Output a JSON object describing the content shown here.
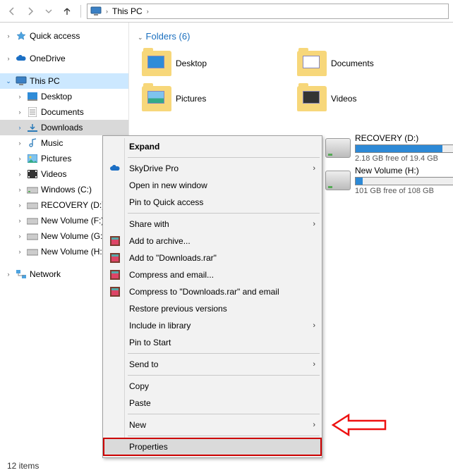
{
  "breadcrumb": {
    "root": "This PC",
    "sep": "›"
  },
  "tree": {
    "quick": "Quick access",
    "onedrive": "OneDrive",
    "thispc": "This PC",
    "desktop": "Desktop",
    "documents": "Documents",
    "downloads": "Downloads",
    "music": "Music",
    "pictures": "Pictures",
    "videos": "Videos",
    "winc": "Windows (C:)",
    "recd": "RECOVERY (D:)",
    "newf": "New Volume (F:)",
    "newg": "New Volume (G:)",
    "newh": "New Volume (H:)",
    "network": "Network"
  },
  "content": {
    "folders_heading": "Folders (6)",
    "f_desktop": "Desktop",
    "f_documents": "Documents",
    "f_pictures": "Pictures",
    "f_videos": "Videos"
  },
  "drives": {
    "rec_name": "RECOVERY (D:)",
    "rec_free": "2.18 GB free of 19.4 GB",
    "newh_name": "New Volume (H:)",
    "newh_free": "101 GB free of 108 GB"
  },
  "context": {
    "expand": "Expand",
    "skydrive": "SkyDrive Pro",
    "opennew": "Open in new window",
    "pin": "Pin to Quick access",
    "share": "Share with",
    "addarch": "Add to archive...",
    "addrar": "Add to \"Downloads.rar\"",
    "compmail": "Compress and email...",
    "comprar": "Compress to \"Downloads.rar\" and email",
    "restore": "Restore previous versions",
    "incl": "Include in library",
    "pinstart": "Pin to Start",
    "sendto": "Send to",
    "copy": "Copy",
    "paste": "Paste",
    "new": "New",
    "prop": "Properties"
  },
  "status": {
    "count": "12 items"
  }
}
